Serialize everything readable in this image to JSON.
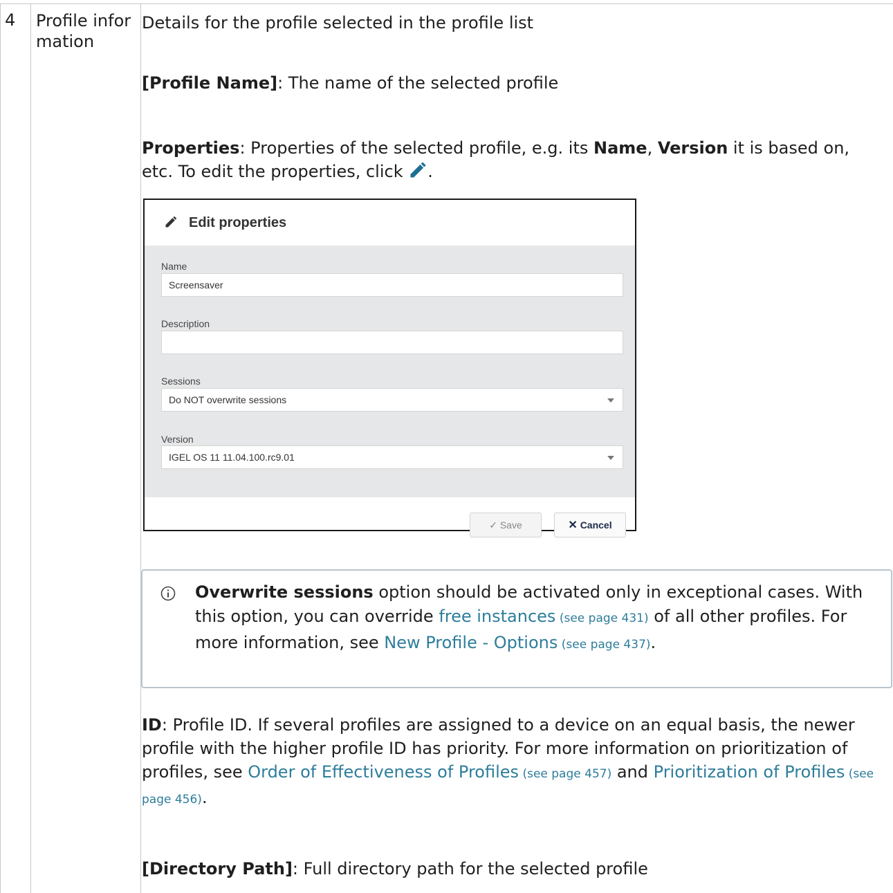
{
  "row": {
    "number": "4",
    "name": "Profile information",
    "details": "Details for the profile selected in the profile list"
  },
  "profile_name": {
    "label": "[Profile Name]",
    "text": ": The name of the selected profile"
  },
  "properties": {
    "label": "Properties",
    "text1": ": Properties of the selected profile, e.g. its ",
    "name_label": "Name",
    "sep": ", ",
    "version_label": "Version",
    "text2": " it is based on, etc. To edit the properties, click ",
    "end": "."
  },
  "dialog": {
    "title": "Edit properties",
    "name_label": "Name",
    "name_value": "Screensaver",
    "description_label": "Description",
    "description_value": "",
    "sessions_label": "Sessions",
    "sessions_value": "Do NOT overwrite sessions",
    "version_label": "Version",
    "version_value": "IGEL OS 11 11.04.100.rc9.01",
    "save_label": "Save",
    "cancel_label": "Cancel"
  },
  "info": {
    "bold": "Overwrite sessions",
    "t1": " option should be activated only in exceptional cases. With this option, you can override ",
    "link1": "free instances",
    "ref1": " (see page 431)",
    "t2": " of all other profiles. For more information, see ",
    "link2": "New Profile - Options",
    "ref2": " (see page 437)",
    "t3": "."
  },
  "id": {
    "label": "ID",
    "t1": ": Profile ID. If several profiles are assigned to a device on an equal basis, the newer profile with the higher profile ID has priority. For more information on prioritization of profiles, see ",
    "link1": "Order of Effectiveness of Profiles",
    "ref1": " (see page 457)",
    "t2": " and ",
    "link2": "Prioritization of Profiles",
    "ref2": " (see page 456)",
    "t3": "."
  },
  "directory": {
    "label": "[Directory Path]",
    "text": ": Full directory path for the selected profile"
  },
  "colors": {
    "link": "#2e7d9b",
    "info_border": "#b9c5cf",
    "dialog_body": "#e6e7e9"
  }
}
